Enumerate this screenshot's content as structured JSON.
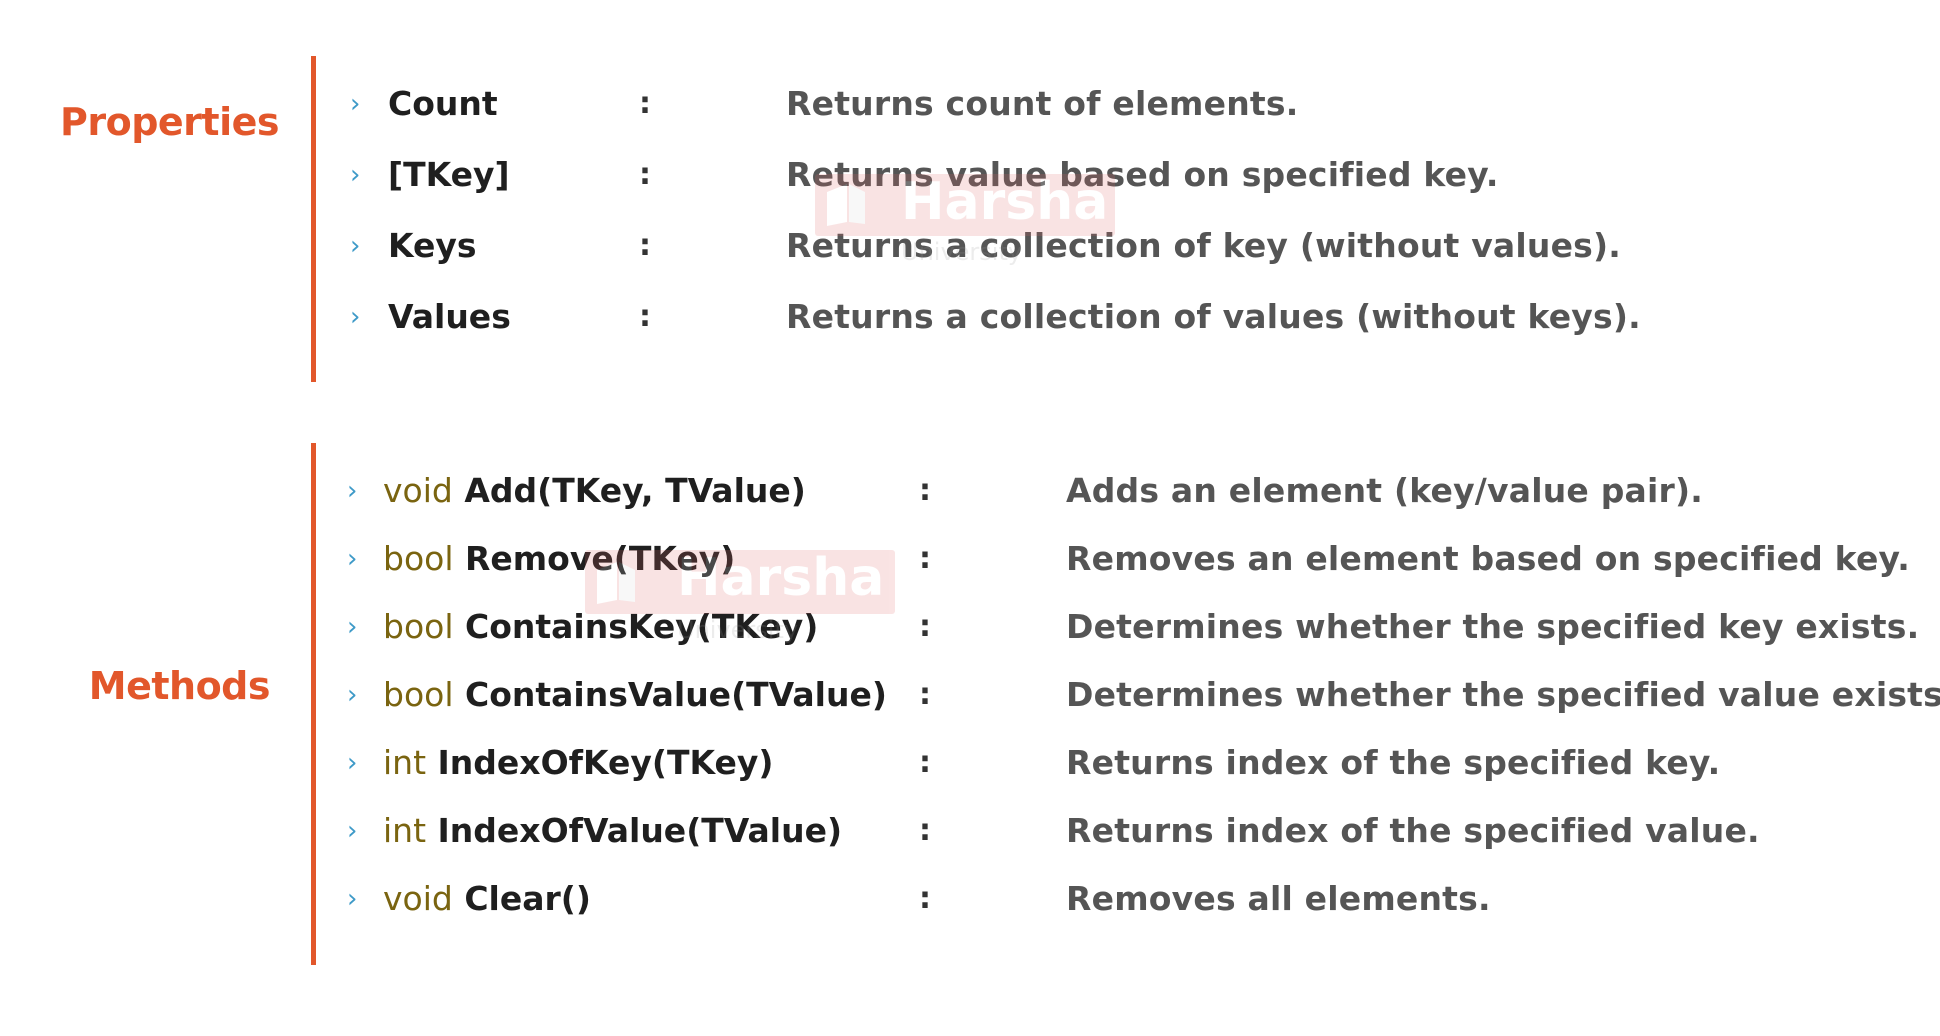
{
  "sections": {
    "properties": {
      "label": "Properties",
      "items": [
        {
          "name": "Count",
          "colon": ":",
          "description": "Returns count of elements."
        },
        {
          "name": "[TKey]",
          "colon": ":",
          "description": "Returns value based on specified key."
        },
        {
          "name": "Keys",
          "colon": ":",
          "description": "Returns a collection of key (without values)."
        },
        {
          "name": "Values",
          "colon": ":",
          "description": "Returns a collection of values (without keys)."
        }
      ]
    },
    "methods": {
      "label": "Methods",
      "items": [
        {
          "return_type": "void",
          "signature": "Add(TKey, TValue)",
          "colon": ":",
          "description": "Adds an element (key/value pair)."
        },
        {
          "return_type": "bool",
          "signature": "Remove(TKey)",
          "colon": ":",
          "description": "Removes an element based on specified key."
        },
        {
          "return_type": "bool",
          "signature": "ContainsKey(TKey)",
          "colon": ":",
          "description": "Determines whether the specified key exists."
        },
        {
          "return_type": "bool",
          "signature": "ContainsValue(TValue)",
          "colon": ":",
          "description": "Determines whether the specified value exists."
        },
        {
          "return_type": "int",
          "signature": "IndexOfKey(TKey)",
          "colon": ":",
          "description": "Returns index of the specified key."
        },
        {
          "return_type": "int",
          "signature": "IndexOfValue(TValue)",
          "colon": ":",
          "description": "Returns index of the specified value."
        },
        {
          "return_type": "void",
          "signature": "Clear()",
          "colon": ":",
          "description": "Removes all elements."
        }
      ]
    }
  },
  "bullet_glyph": "›",
  "watermark": {
    "text": "Harsha",
    "subtext": "University"
  },
  "colors": {
    "accent": "#E2572B",
    "bullet": "#3E9AC8",
    "return_type": "#7A6410",
    "name": "#1F1F1F",
    "description": "#555555"
  }
}
